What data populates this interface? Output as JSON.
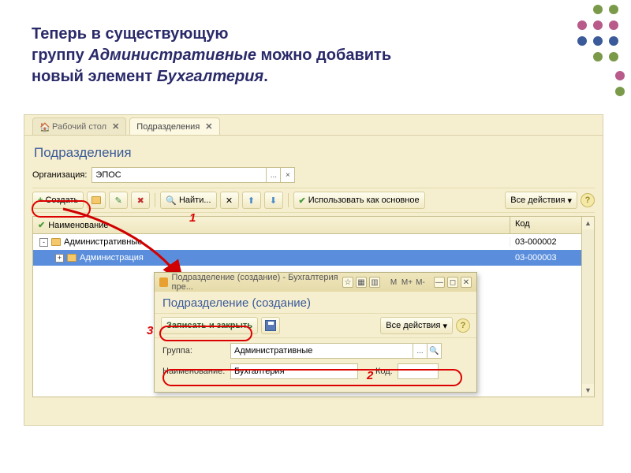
{
  "slide": {
    "l1": "Теперь в существующую",
    "l2a": "группу ",
    "l2b": "Административные",
    "l2c": " можно добавить",
    "l3a": "новый элемент ",
    "l3b": "Бухгалтерия",
    "l3c": "."
  },
  "tabs": {
    "t1": "Рабочий стол",
    "t2": "Подразделения"
  },
  "panel": {
    "title": "Подразделения",
    "orgLabel": "Организация:",
    "orgValue": "ЭПОС",
    "orgClear": "×"
  },
  "toolbar": {
    "create": "Создать",
    "find": "Найти...",
    "useMain": "Использовать как основное",
    "allActions": "Все действия",
    "help": "?"
  },
  "grid": {
    "hName": "Наименование",
    "hCode": "Код",
    "rows": [
      {
        "name": "Административные",
        "code": "03-000002",
        "indent": 0,
        "toggle": "-"
      },
      {
        "name": "Администрация",
        "code": "03-000003",
        "indent": 1,
        "toggle": "+",
        "selected": true
      }
    ]
  },
  "dialog": {
    "winTitle": "Подразделение (создание) - Бухгалтерия пре...",
    "m": "M",
    "mp": "M+",
    "mm": "M-",
    "head": "Подразделение (создание)",
    "save": "Записать и закрыть",
    "allActions": "Все действия",
    "help": "?",
    "groupLabel": "Группа:",
    "groupValue": "Административные",
    "nameLabel": "Наименование:",
    "nameValue": "Бухгалтерия",
    "codeLabel": "Код:",
    "codeValue": ""
  },
  "marks": {
    "n1": "1",
    "n2": "2",
    "n3": "3"
  },
  "icons": {
    "plus": "+",
    "pencil": "✎",
    "del": "✖",
    "magnifier": "🔍",
    "magx": "✕",
    "up": "⬆",
    "down": "⬇",
    "check": "✔",
    "dots": "...",
    "tri": "▾",
    "star": "☆",
    "calc": "▦",
    "cal": "▥",
    "min": "—",
    "max": "◻",
    "close": "✕"
  }
}
